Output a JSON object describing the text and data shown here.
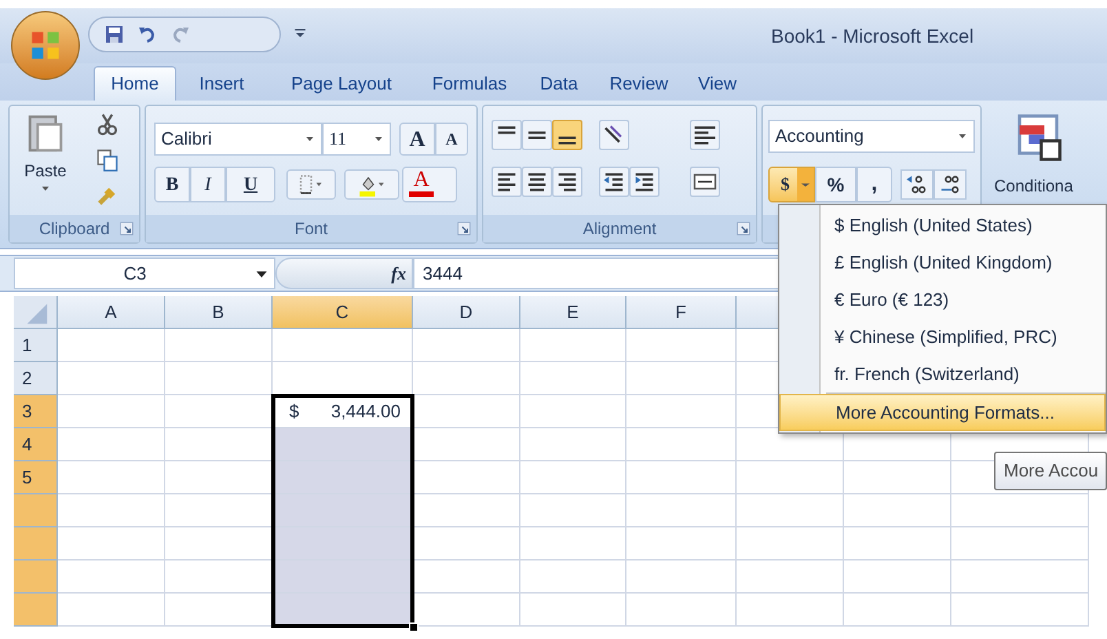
{
  "window": {
    "title": "Book1 - Microsoft Excel"
  },
  "tabs": [
    {
      "label": "Home",
      "selected": true
    },
    {
      "label": "Insert",
      "selected": false
    },
    {
      "label": "Page Layout",
      "selected": false
    },
    {
      "label": "Formulas",
      "selected": false
    },
    {
      "label": "Data",
      "selected": false
    },
    {
      "label": "Review",
      "selected": false
    },
    {
      "label": "View",
      "selected": false
    }
  ],
  "ribbon": {
    "clipboard": {
      "paste": "Paste",
      "group_label": "Clipboard"
    },
    "font": {
      "name": "Calibri",
      "size": "11",
      "grow": "A",
      "shrink": "A",
      "bold": "B",
      "italic": "I",
      "underline": "U",
      "font_color": "A",
      "group_label": "Font"
    },
    "alignment": {
      "group_label": "Alignment"
    },
    "number": {
      "format": "Accounting",
      "currency": "$",
      "percent": "%",
      "comma": ","
    },
    "styles": {
      "conditional_formatting": "Conditiona"
    }
  },
  "formula_bar": {
    "name_box": "C3",
    "function_label": "fx",
    "formula": "3444"
  },
  "sheet": {
    "columns": [
      {
        "label": "A",
        "selected": false
      },
      {
        "label": "B",
        "selected": false
      },
      {
        "label": "C",
        "selected": true
      },
      {
        "label": "D",
        "selected": false
      },
      {
        "label": "E",
        "selected": false
      },
      {
        "label": "F",
        "selected": false
      }
    ],
    "rows": [
      {
        "label": "1",
        "selected": false
      },
      {
        "label": "2",
        "selected": false
      },
      {
        "label": "3",
        "selected": true
      },
      {
        "label": "4",
        "selected": true
      },
      {
        "label": "5",
        "selected": true
      },
      {
        "selected": true
      },
      {
        "selected": true
      },
      {
        "selected": true
      },
      {
        "selected": true
      }
    ],
    "active_cell": {
      "symbol": "$",
      "value": "3,444.00"
    }
  },
  "currency_menu": {
    "items": [
      {
        "label": "$ English (United States)",
        "selected": false
      },
      {
        "label": "£ English (United Kingdom)",
        "selected": false
      },
      {
        "label": "€ Euro (€ 123)",
        "selected": false
      },
      {
        "label": "¥ Chinese (Simplified, PRC)",
        "selected": false
      },
      {
        "label": "fr. French (Switzerland)",
        "selected": false
      },
      {
        "label": "More Accounting Formats...",
        "selected": true
      }
    ]
  },
  "tooltip": {
    "text": "More Accou"
  }
}
